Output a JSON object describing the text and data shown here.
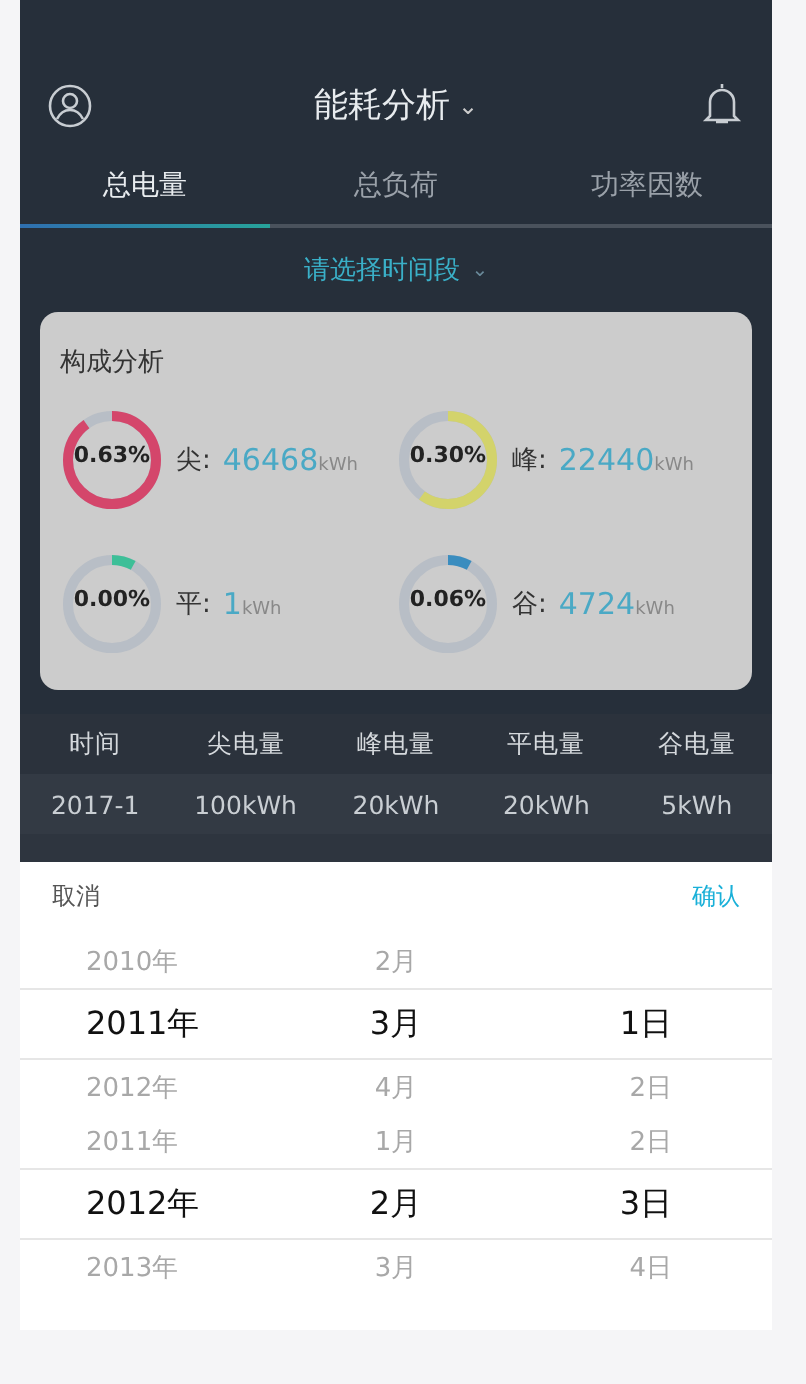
{
  "header": {
    "title": "能耗分析",
    "caret": "⌄"
  },
  "tabs": [
    {
      "label": "总电量",
      "selected": true
    },
    {
      "label": "总负荷",
      "selected": false
    },
    {
      "label": "功率因数",
      "selected": false
    }
  ],
  "period_select": {
    "label": "请选择时间段",
    "caret": "⌄"
  },
  "composition": {
    "title": "构成分析",
    "items": [
      {
        "percent": "0.63%",
        "name": "尖:",
        "value": "46468",
        "unit": "kWh",
        "level": 0.9,
        "color": "#d4466b"
      },
      {
        "percent": "0.30%",
        "name": "峰:",
        "value": "22440",
        "unit": "kWh",
        "level": 0.6,
        "color": "#d3d36b"
      },
      {
        "percent": "0.00%",
        "name": "平:",
        "value": "1",
        "unit": "kWh",
        "level": 0.08,
        "color": "#3dbf98"
      },
      {
        "percent": "0.06%",
        "name": "谷:",
        "value": "4724",
        "unit": "kWh",
        "level": 0.08,
        "color": "#3a8dbf"
      }
    ]
  },
  "table": {
    "columns": [
      "时间",
      "尖电量",
      "峰电量",
      "平电量",
      "谷电量"
    ],
    "rows": [
      [
        "2017-1",
        "100kWh",
        "20kWh",
        "20kWh",
        "5kWh"
      ]
    ]
  },
  "picker": {
    "cancel": "取消",
    "confirm": "确认",
    "rows": [
      {
        "selected": false,
        "cells": [
          "2010年",
          "2月"
        ]
      },
      {
        "selected": true,
        "cells": [
          "2011年",
          "3月",
          "1日"
        ]
      },
      {
        "selected": false,
        "cells": [
          "2012年",
          "4月",
          "2日"
        ]
      },
      {
        "selected": false,
        "cells": [
          "2011年",
          "1月",
          "2日"
        ]
      },
      {
        "selected": true,
        "cells": [
          "2012年",
          "2月",
          "3日"
        ]
      },
      {
        "selected": false,
        "cells": [
          "2013年",
          "3月",
          "4日"
        ]
      }
    ]
  }
}
